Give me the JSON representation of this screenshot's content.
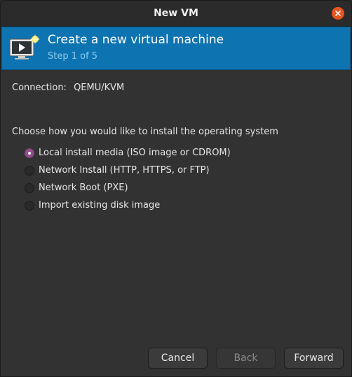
{
  "window": {
    "title": "New VM"
  },
  "banner": {
    "title": "Create a new virtual machine",
    "step": "Step 1 of 5",
    "icon": "vm-new-icon"
  },
  "connection": {
    "label": "Connection:",
    "value": "QEMU/KVM"
  },
  "install": {
    "prompt": "Choose how you would like to install the operating system",
    "options": [
      {
        "label": "Local install media (ISO image or CDROM)",
        "selected": true
      },
      {
        "label": "Network Install (HTTP, HTTPS, or FTP)",
        "selected": false
      },
      {
        "label": "Network Boot (PXE)",
        "selected": false
      },
      {
        "label": "Import existing disk image",
        "selected": false
      }
    ]
  },
  "buttons": {
    "cancel": "Cancel",
    "back": "Back",
    "forward": "Forward"
  },
  "colors": {
    "accent": "#0e73b1",
    "close": "#e95420",
    "radio_selected": "#924d8b"
  }
}
